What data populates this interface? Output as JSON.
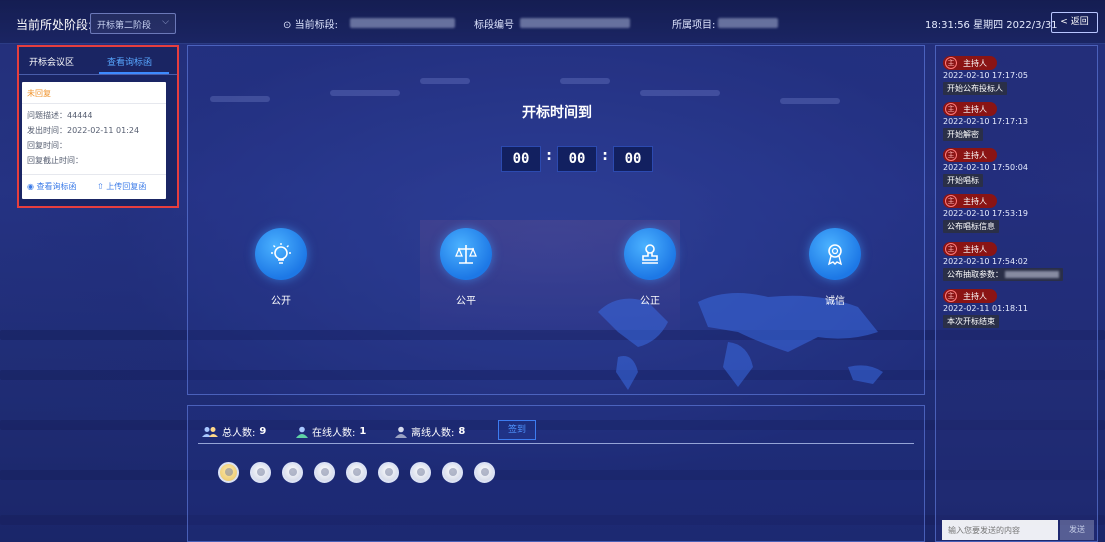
{
  "header": {
    "stage_label": "当前所处阶段:",
    "stage_select_value": "开标第二阶段",
    "current_section_label": "当前标段:",
    "section_no_label": "标段编号",
    "project_label": "所属项目:",
    "clock": "18:31:56 星期四 2022/3/31",
    "back_label": "返回"
  },
  "left_panel": {
    "tabs": [
      "开标会议区",
      "查看询标函"
    ],
    "card": {
      "status": "未回复",
      "lines": [
        "问题描述：44444",
        "发出时间：2022-02-11 01:24",
        "回复时间：",
        "回复截止时间："
      ],
      "view_action": "查看询标函",
      "upload_action": "上传回复函"
    }
  },
  "main": {
    "title": "开标时间到",
    "timer": {
      "hours": "00",
      "minutes": "00",
      "seconds": "00",
      "separator": ":"
    },
    "values": [
      {
        "label": "公开",
        "icon": "lightbulb-icon"
      },
      {
        "label": "公平",
        "icon": "scales-icon"
      },
      {
        "label": "公正",
        "icon": "stamp-icon"
      },
      {
        "label": "诚信",
        "icon": "medal-icon"
      }
    ]
  },
  "attendance": {
    "total_label": "总人数:",
    "total_value": "9",
    "online_label": "在线人数:",
    "online_value": "1",
    "offline_label": "离线人数:",
    "offline_value": "8",
    "sign_in_label": "签到",
    "avatars": [
      "online",
      "offline",
      "offline",
      "offline",
      "offline",
      "offline",
      "offline",
      "offline",
      "offline"
    ]
  },
  "log": {
    "badge": "主",
    "entries": [
      {
        "host": "主持人",
        "time": "2022-02-10 17:17:05",
        "message": "开始公布投标人"
      },
      {
        "host": "主持人",
        "time": "2022-02-10 17:17:13",
        "message": "开始解密"
      },
      {
        "host": "主持人",
        "time": "2022-02-10 17:50:04",
        "message": "开始唱标"
      },
      {
        "host": "主持人",
        "time": "2022-02-10 17:53:19",
        "message": "公布唱标信息"
      },
      {
        "host": "主持人",
        "time": "2022-02-10 17:54:02",
        "message": "公布抽取参数："
      },
      {
        "host": "主持人",
        "time": "2022-02-11 01:18:11",
        "message": "本次开标结束"
      }
    ],
    "input_placeholder": "输入您要发送的内容",
    "send_label": "发送"
  },
  "colors": {
    "accent": "#3d8bff",
    "highlight_border": "#e63e3e",
    "status_pending": "#f0932b",
    "host_tag": "#8a1414"
  }
}
